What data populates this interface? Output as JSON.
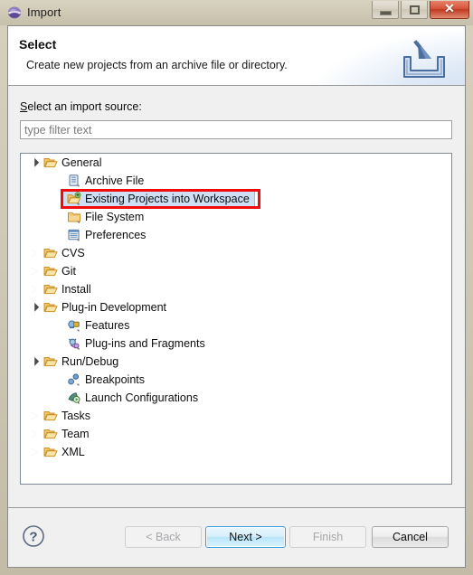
{
  "window": {
    "title": "Import",
    "icon": "eclipse-sphere-icon",
    "controls": {
      "minimize": "minimize-button",
      "maximize": "maximize-button",
      "close": "close-button",
      "close_glyph": "✕"
    }
  },
  "header": {
    "title": "Select",
    "description": "Create new projects from an archive file or directory.",
    "icon": "import-wizard-icon"
  },
  "body": {
    "source_label_prefix": "S",
    "source_label_rest": "elect an import source:",
    "filter": {
      "value": "",
      "placeholder": "type filter text"
    }
  },
  "tree": {
    "selected_item": "Existing Projects into Workspace",
    "annotation_color": "#f30b0b",
    "selection_bg": "#cedff5",
    "items": [
      {
        "label": "General",
        "depth": 0,
        "state": "expanded",
        "icon": "folder-open-icon",
        "selected": false
      },
      {
        "label": "Archive File",
        "depth": 1,
        "state": "leaf",
        "icon": "archive-file-icon",
        "selected": false
      },
      {
        "label": "Existing Projects into Workspace",
        "depth": 1,
        "state": "leaf",
        "icon": "project-import-icon",
        "selected": true
      },
      {
        "label": "File System",
        "depth": 1,
        "state": "leaf",
        "icon": "file-system-icon",
        "selected": false
      },
      {
        "label": "Preferences",
        "depth": 1,
        "state": "leaf",
        "icon": "preferences-icon",
        "selected": false
      },
      {
        "label": "CVS",
        "depth": 0,
        "state": "collapsed",
        "icon": "folder-open-icon",
        "selected": false
      },
      {
        "label": "Git",
        "depth": 0,
        "state": "collapsed",
        "icon": "folder-open-icon",
        "selected": false
      },
      {
        "label": "Install",
        "depth": 0,
        "state": "collapsed",
        "icon": "folder-open-icon",
        "selected": false
      },
      {
        "label": "Plug-in Development",
        "depth": 0,
        "state": "expanded",
        "icon": "folder-open-icon",
        "selected": false
      },
      {
        "label": "Features",
        "depth": 1,
        "state": "leaf",
        "icon": "feature-icon",
        "selected": false
      },
      {
        "label": "Plug-ins and Fragments",
        "depth": 1,
        "state": "leaf",
        "icon": "plugin-icon",
        "selected": false
      },
      {
        "label": "Run/Debug",
        "depth": 0,
        "state": "expanded",
        "icon": "folder-open-icon",
        "selected": false
      },
      {
        "label": "Breakpoints",
        "depth": 1,
        "state": "leaf",
        "icon": "breakpoint-icon",
        "selected": false
      },
      {
        "label": "Launch Configurations",
        "depth": 1,
        "state": "leaf",
        "icon": "launch-config-icon",
        "selected": false
      },
      {
        "label": "Tasks",
        "depth": 0,
        "state": "collapsed",
        "icon": "folder-open-icon",
        "selected": false
      },
      {
        "label": "Team",
        "depth": 0,
        "state": "collapsed",
        "icon": "folder-open-icon",
        "selected": false
      },
      {
        "label": "XML",
        "depth": 0,
        "state": "collapsed",
        "icon": "folder-open-icon",
        "selected": false
      }
    ]
  },
  "footer": {
    "help_icon": "help-question-icon",
    "buttons": [
      {
        "id": "back",
        "label": "< Back",
        "mnemonic": "B",
        "enabled": false,
        "default": false
      },
      {
        "id": "next",
        "label": "Next >",
        "mnemonic": "",
        "enabled": true,
        "default": true
      },
      {
        "id": "finish",
        "label": "Finish",
        "mnemonic": "F",
        "enabled": false,
        "default": false
      },
      {
        "id": "cancel",
        "label": "Cancel",
        "mnemonic": "",
        "enabled": true,
        "default": false
      }
    ]
  }
}
